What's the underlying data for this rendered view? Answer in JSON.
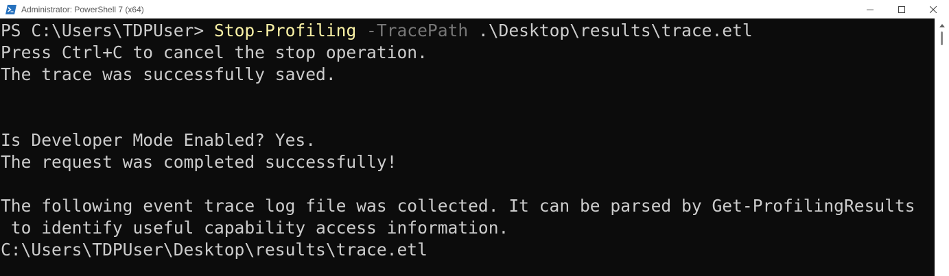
{
  "window": {
    "title": "Administrator: PowerShell 7 (x64)",
    "app_icon": "powershell-icon",
    "controls": [
      "minimize-icon",
      "maximize-icon",
      "close-icon"
    ]
  },
  "console": {
    "prompt": "PS C:\\Users\\TDPUser> ",
    "command_name": "Stop-Profiling",
    "command_param": " -TracePath",
    "command_arg": " .\\Desktop\\results\\trace.etl",
    "lines": [
      "Press Ctrl+C to cancel the stop operation.",
      "The trace was successfully saved.",
      "",
      "",
      "Is Developer Mode Enabled? Yes.",
      "The request was completed successfully!",
      "",
      "The following event trace log file was collected. It can be parsed by Get-ProfilingResults",
      " to identify useful capability access information.",
      "C:\\Users\\TDPUser\\Desktop\\results\\trace.etl"
    ]
  },
  "colors": {
    "background": "#0c0c0c",
    "foreground": "#cccccc",
    "command": "#f9f1a5",
    "parameter": "#767676"
  }
}
